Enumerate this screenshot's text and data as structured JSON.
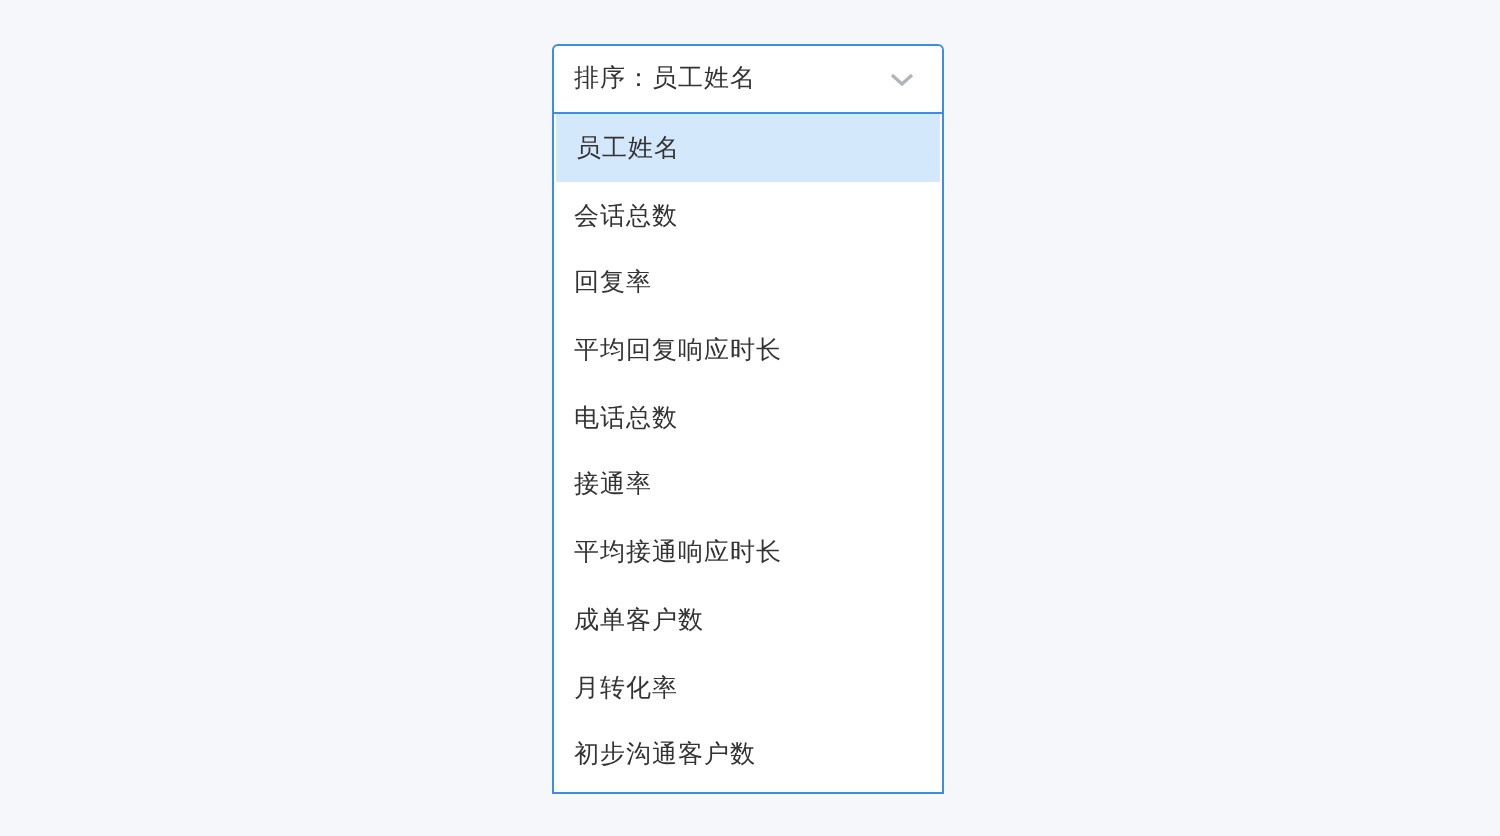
{
  "select": {
    "value": "排序：员工姓名",
    "expanded": true
  },
  "options": [
    {
      "label": "员工姓名",
      "selected": true
    },
    {
      "label": "会话总数",
      "selected": false
    },
    {
      "label": "回复率",
      "selected": false
    },
    {
      "label": "平均回复响应时长",
      "selected": false
    },
    {
      "label": "电话总数",
      "selected": false
    },
    {
      "label": "接通率",
      "selected": false
    },
    {
      "label": "平均接通响应时长",
      "selected": false
    },
    {
      "label": "成单客户数",
      "selected": false
    },
    {
      "label": "月转化率",
      "selected": false
    },
    {
      "label": "初步沟通客户数",
      "selected": false
    }
  ]
}
